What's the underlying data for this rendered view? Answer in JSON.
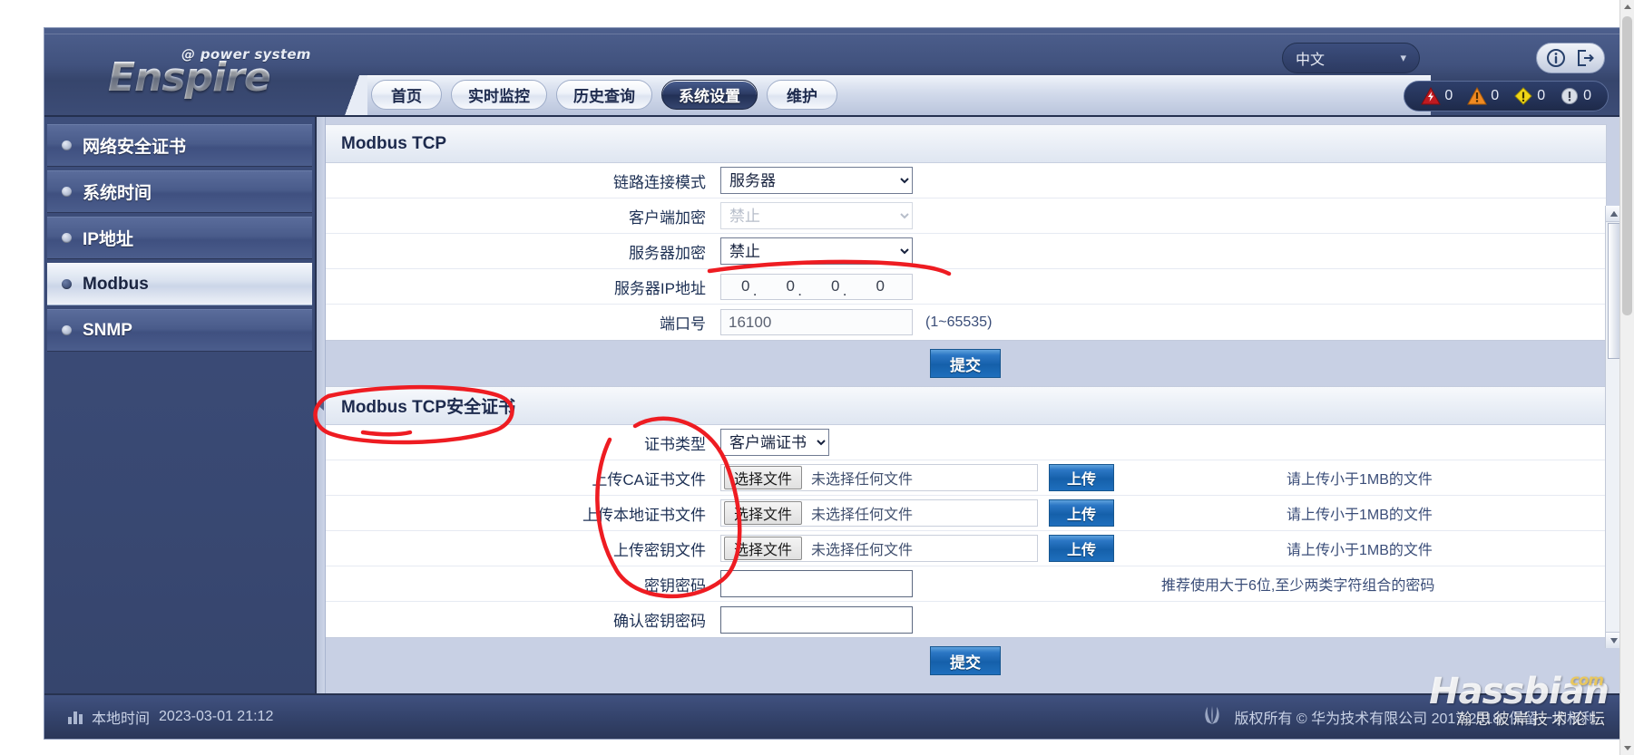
{
  "header": {
    "logo_top": "@ power system",
    "logo_main": "Enspire",
    "language": "中文",
    "lang_chevron": "˅",
    "tabs": [
      {
        "label": "首页",
        "active": false
      },
      {
        "label": "实时监控",
        "active": false
      },
      {
        "label": "历史查询",
        "active": false
      },
      {
        "label": "系统设置",
        "active": true
      },
      {
        "label": "维护",
        "active": false
      }
    ],
    "user_icons": [
      {
        "name": "info-icon",
        "glyph": "i"
      },
      {
        "name": "logout-icon",
        "glyph": "→"
      }
    ],
    "alarms": [
      {
        "name": "critical-alarm",
        "count": "0",
        "color": "#c01a20"
      },
      {
        "name": "major-alarm",
        "count": "0",
        "color": "#f08a22"
      },
      {
        "name": "minor-alarm",
        "count": "0",
        "color": "#f0d617"
      },
      {
        "name": "warning-alarm",
        "count": "0",
        "color": "#d8dde6"
      }
    ]
  },
  "sidebar": {
    "items": [
      {
        "label": "网络安全证书",
        "active": false
      },
      {
        "label": "系统时间",
        "active": false
      },
      {
        "label": "IP地址",
        "active": false
      },
      {
        "label": "Modbus",
        "active": true
      },
      {
        "label": "SNMP",
        "active": false
      }
    ]
  },
  "modbus_tcp": {
    "panel_title": "Modbus TCP",
    "rows": {
      "link_mode": {
        "label": "链路连接模式",
        "value": "服务器",
        "disabled": false
      },
      "client_encrypt": {
        "label": "客户端加密",
        "value": "禁止",
        "disabled": true
      },
      "server_encrypt": {
        "label": "服务器加密",
        "value": "禁止",
        "disabled": false
      },
      "server_ip": {
        "label": "服务器IP地址",
        "octets": [
          "0",
          "0",
          "0",
          "0"
        ],
        "disabled": true
      },
      "port": {
        "label": "端口号",
        "value": "16100",
        "hint": "(1~65535)",
        "disabled": true
      }
    },
    "submit_label": "提交"
  },
  "modbus_cert": {
    "panel_title": "Modbus TCP安全证书",
    "cert_type": {
      "label": "证书类型",
      "value": "客户端证书"
    },
    "file_rows": [
      {
        "label": "上传CA证书文件",
        "choose_label": "选择文件",
        "file_status": "未选择任何文件",
        "upload_label": "上传",
        "hint": "请上传小于1MB的文件"
      },
      {
        "label": "上传本地证书文件",
        "choose_label": "选择文件",
        "file_status": "未选择任何文件",
        "upload_label": "上传",
        "hint": "请上传小于1MB的文件"
      },
      {
        "label": "上传密钥文件",
        "choose_label": "选择文件",
        "file_status": "未选择任何文件",
        "upload_label": "上传",
        "hint": "请上传小于1MB的文件"
      }
    ],
    "password_rows": [
      {
        "label": "密钥密码",
        "value": "",
        "hint": "推荐使用大于6位,至少两类字符组合的密码"
      },
      {
        "label": "确认密钥密码",
        "value": "",
        "hint": ""
      }
    ],
    "submit_label": "提交"
  },
  "footer": {
    "local_time_label": "本地时间",
    "local_time_value": "2023-03-01 21:12",
    "copyright": "版权所有 © 华为技术有限公司 2017-2018. 保留一切权利"
  },
  "watermark": {
    "main": "Hassbian",
    "com": "com",
    "sub": "瀚思彼岸技术论坛"
  }
}
